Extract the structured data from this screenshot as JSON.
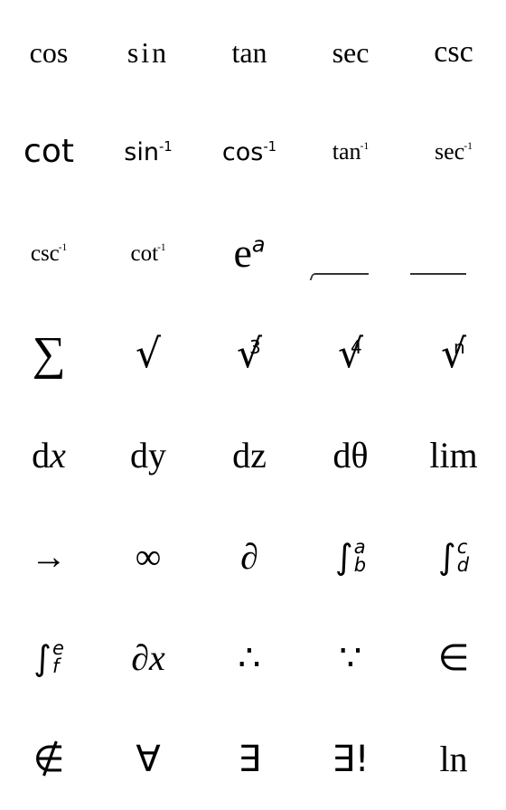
{
  "symbols": {
    "cos": "cos",
    "sin": "sin",
    "tan": "tan",
    "sec": "sec",
    "csc": "csc",
    "cot": "cot",
    "arcsin": {
      "base": "sin",
      "sup": "-1"
    },
    "arccos": {
      "base": "cos",
      "sup": "-1"
    },
    "arctan": {
      "base": "tan",
      "sup": "-1"
    },
    "arcsec": {
      "base": "sec",
      "sup": "-1"
    },
    "arccsc": {
      "base": "csc",
      "sup": "-1"
    },
    "arccot": {
      "base": "cot",
      "sup": "-1"
    },
    "exp": {
      "base": "e",
      "sup": "a"
    },
    "sum": "∑",
    "sqrt": "√",
    "cbrt": {
      "index": "3",
      "radical": "√"
    },
    "root4": {
      "index": "4",
      "radical": "√"
    },
    "rootn": {
      "index": "n",
      "radical": "√"
    },
    "dx": {
      "d": "d",
      "var": "x"
    },
    "dy": "dy",
    "dz": "dz",
    "dtheta": "dθ",
    "lim": "lim",
    "arrow": "→",
    "infinity": "∞",
    "partial": "∂",
    "int_ab": {
      "sign": "∫",
      "upper": "a",
      "lower": "b"
    },
    "int_cd": {
      "sign": "∫",
      "upper": "c",
      "lower": "d"
    },
    "int_ef": {
      "sign": "∫",
      "upper": "e",
      "lower": "f"
    },
    "partial_x": {
      "partial": "∂",
      "var": "x"
    },
    "therefore": "∴",
    "because": "∵",
    "element_of": "∈",
    "not_element_of": "∉",
    "for_all": "∀",
    "exists": "∃",
    "exists_unique": "∃!",
    "ln": "ln"
  }
}
